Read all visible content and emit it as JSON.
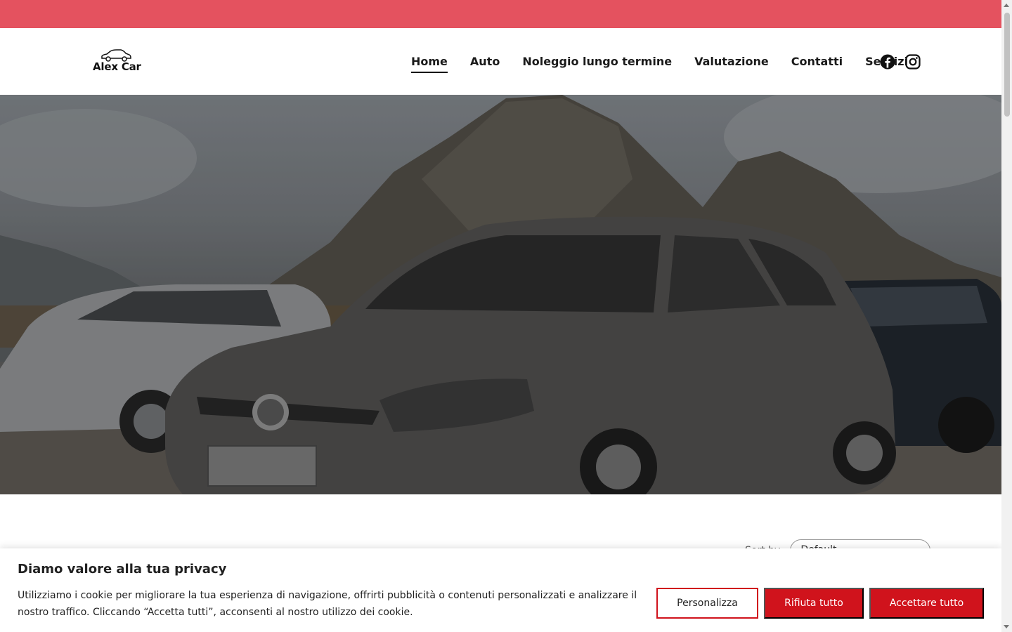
{
  "brand": {
    "name": "Alex Car",
    "topbar_color": "#e4525f"
  },
  "nav": {
    "items": [
      {
        "label": "Home",
        "active": true
      },
      {
        "label": "Auto",
        "active": false
      },
      {
        "label": "Noleggio lungo termine",
        "active": false
      },
      {
        "label": "Valutazione",
        "active": false
      },
      {
        "label": "Contatti",
        "active": false
      },
      {
        "label": "Servizi",
        "active": false
      }
    ],
    "social": [
      "facebook-icon",
      "instagram-icon"
    ]
  },
  "hero": {
    "image": "cars-in-front-of-mountains"
  },
  "sort": {
    "label": "Sort by",
    "value": "Default"
  },
  "cookie_banner": {
    "title": "Diamo valore alla tua privacy",
    "text": "Utilizziamo i cookie per migliorare la tua esperienza di navigazione, offrirti pubblicità o contenuti personalizzati e analizzare il nostro traffico. Cliccando “Accetta tutti”, acconsenti al nostro utilizzo dei cookie.",
    "buttons": {
      "customize": "Personalizza",
      "reject": "Rifiuta tutto",
      "accept": "Accettare tutto"
    },
    "accent_color": "#d0131c"
  }
}
